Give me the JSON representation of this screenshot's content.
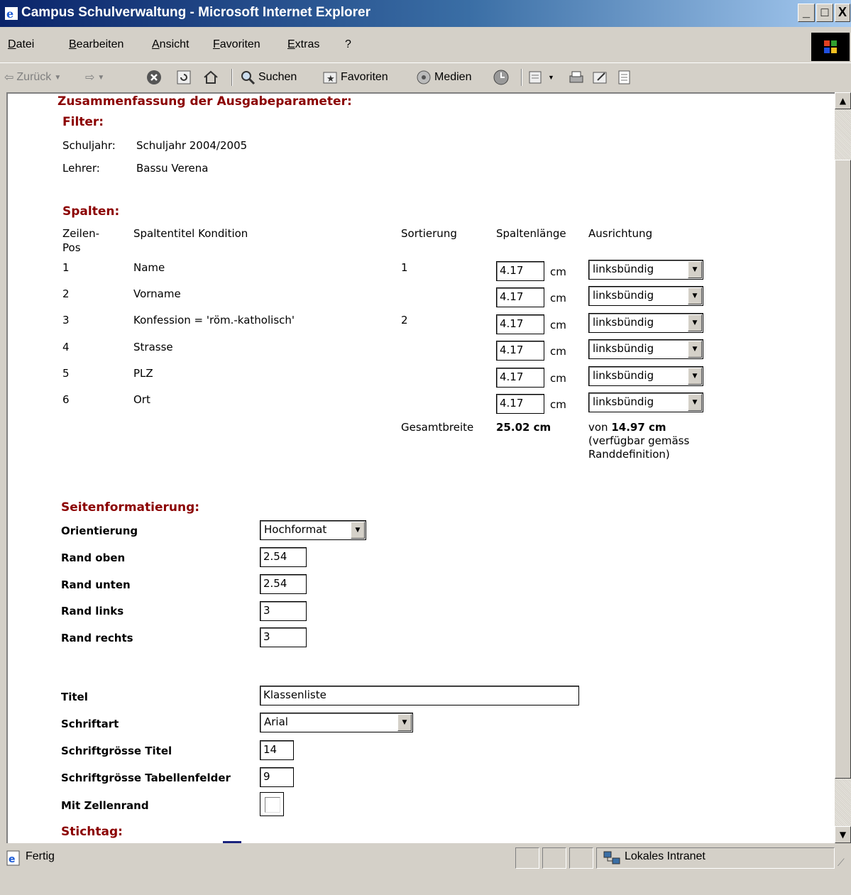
{
  "window": {
    "title": "Campus Schulverwaltung - Microsoft Internet Explorer"
  },
  "menu": [
    "Datei",
    "Bearbeiten",
    "Ansicht",
    "Favoriten",
    "Extras",
    "?"
  ],
  "toolbar": {
    "back": "Zurück",
    "search": "Suchen",
    "favorites": "Favoriten",
    "media": "Medien"
  },
  "summary_heading": "Zusammenfassung der Ausgabeparameter:",
  "filter": {
    "heading": "Filter:",
    "schuljahr_label": "Schuljahr:",
    "schuljahr_value": "Schuljahr 2004/2005",
    "lehrer_label": "Lehrer:",
    "lehrer_value": "Bassu Verena"
  },
  "columns": {
    "heading": "Spalten:",
    "headers": {
      "pos_line1": "Zeilen-",
      "pos_line2": "Pos",
      "title": "Spaltentitel Kondition",
      "sort": "Sortierung",
      "length": "Spaltenlänge",
      "align": "Ausrichtung"
    },
    "unit": "cm",
    "rows": [
      {
        "pos": "1",
        "title": "Name",
        "sort": "1",
        "length": "4.17",
        "align": "linksbündig"
      },
      {
        "pos": "2",
        "title": "Vorname",
        "sort": "",
        "length": "4.17",
        "align": "linksbündig"
      },
      {
        "pos": "3",
        "title": "Konfession = 'röm.-katholisch'",
        "sort": "2",
        "length": "4.17",
        "align": "linksbündig"
      },
      {
        "pos": "4",
        "title": "Strasse",
        "sort": "",
        "length": "4.17",
        "align": "linksbündig"
      },
      {
        "pos": "5",
        "title": "PLZ",
        "sort": "",
        "length": "4.17",
        "align": "linksbündig"
      },
      {
        "pos": "6",
        "title": "Ort",
        "sort": "",
        "length": "4.17",
        "align": "linksbündig"
      }
    ],
    "total_label": "Gesamtbreite",
    "total_value": "25.02 cm",
    "available_prefix": "von",
    "available_value": "14.97 cm",
    "available_note_1": "(verfügbar gemäss",
    "available_note_2": "Randdefinition)"
  },
  "page_format": {
    "heading": "Seitenformatierung:",
    "orientation_label": "Orientierung",
    "orientation_value": "Hochformat",
    "margin_top_label": "Rand oben",
    "margin_top_value": "2.54",
    "margin_bottom_label": "Rand unten",
    "margin_bottom_value": "2.54",
    "margin_left_label": "Rand links",
    "margin_left_value": "3",
    "margin_right_label": "Rand rechts",
    "margin_right_value": "3"
  },
  "layout": {
    "title_label": "Titel",
    "title_value": "Klassenliste",
    "font_label": "Schriftart",
    "font_value": "Arial",
    "title_size_label": "Schriftgrösse Titel",
    "title_size_value": "14",
    "table_size_label": "Schriftgrösse Tabellenfelder",
    "table_size_value": "9",
    "border_label": "Mit Zellenrand",
    "border_checked": false
  },
  "stichtag": {
    "heading": "Stichtag:"
  },
  "status": {
    "text": "Fertig",
    "zone": "Lokales Intranet"
  }
}
